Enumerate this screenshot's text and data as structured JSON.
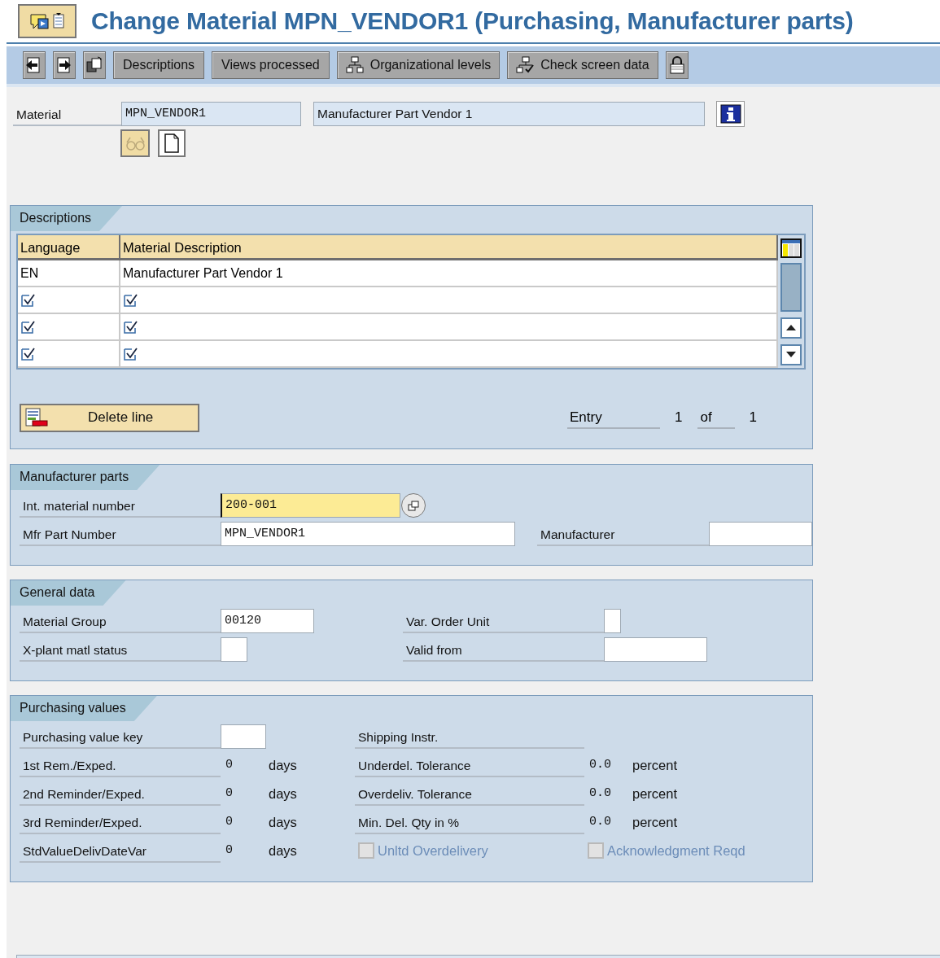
{
  "window": {
    "title": "Change Material MPN_VENDOR1 (Purchasing, Manufacturer parts)"
  },
  "toolbar": {
    "buttons": [
      {
        "kind": "prev"
      },
      {
        "kind": "next"
      },
      {
        "kind": "other"
      },
      {
        "kind": "text",
        "label": "Descriptions"
      },
      {
        "kind": "text",
        "label": "Views processed"
      },
      {
        "kind": "org",
        "label": "Organizational levels"
      },
      {
        "kind": "check",
        "label": "Check screen data"
      },
      {
        "kind": "lock"
      }
    ]
  },
  "header": {
    "label": "Material",
    "value": "MPN_VENDOR1",
    "description": "Manufacturer Part Vendor 1"
  },
  "descriptions": {
    "title": "Descriptions",
    "columns": [
      "Language",
      "Material Description"
    ],
    "rows": [
      {
        "kind": "filled",
        "cells": [
          "EN",
          "Manufacturer Part Vendor 1"
        ]
      },
      {
        "kind": "empty"
      },
      {
        "kind": "empty"
      },
      {
        "kind": "empty"
      }
    ],
    "delete_button": "Delete line",
    "entry": {
      "label": "Entry",
      "current": "1",
      "of": "of",
      "total": "1"
    }
  },
  "manufacturer_parts": {
    "title": "Manufacturer parts",
    "rows": [
      {
        "cells": [
          {
            "kind": "input",
            "label": "Int. material number",
            "value": "200-001",
            "focused": true
          }
        ]
      },
      {
        "cells": [
          {
            "kind": "input",
            "label": "Mfr Part Number",
            "value": "MPN_VENDOR1",
            "focused": false
          },
          {
            "kind": "input",
            "label": "Manufacturer",
            "focused": false
          }
        ]
      }
    ]
  },
  "general_data": {
    "title": "General data",
    "rows": [
      {
        "cells": [
          {
            "kind": "input",
            "label": "Material Group",
            "value": "00120"
          },
          {
            "kind": "input",
            "label": "Var. Order Unit"
          }
        ]
      },
      {
        "cells": [
          {
            "kind": "input",
            "label": "X-plant matl status"
          },
          {
            "kind": "input",
            "label": "Valid from"
          }
        ]
      }
    ]
  },
  "purchasing_values": {
    "title": "Purchasing values",
    "rows": [
      {
        "cells": [
          {
            "kind": "input",
            "label": "Purchasing value key"
          },
          {
            "kind": "label",
            "label": "Shipping Instr."
          }
        ]
      },
      {
        "cells": [
          {
            "kind": "value",
            "label": "1st Rem./Exped.",
            "value": "0",
            "unit": "days"
          },
          {
            "kind": "value",
            "label": "Underdel. Tolerance",
            "value": "0.0",
            "unit": "percent"
          }
        ]
      },
      {
        "cells": [
          {
            "kind": "value",
            "label": "2nd Reminder/Exped.",
            "value": "0",
            "unit": "days"
          },
          {
            "kind": "value",
            "label": "Overdeliv. Tolerance",
            "value": "0.0",
            "unit": "percent"
          }
        ]
      },
      {
        "cells": [
          {
            "kind": "value",
            "label": "3rd Reminder/Exped.",
            "value": "0",
            "unit": "days"
          },
          {
            "kind": "value",
            "label": "Min. Del. Qty in %",
            "value": "0.0",
            "unit": "percent"
          }
        ]
      },
      {
        "cells": [
          {
            "kind": "value",
            "label": "StdValueDelivDateVar",
            "value": "0",
            "unit": "days"
          },
          {
            "kind": "checkbox",
            "label": "Unltd Overdelivery",
            "checked": false,
            "disabled": true
          },
          {
            "kind": "checkbox",
            "label": "Acknowledgment Reqd",
            "checked": false,
            "disabled": true
          }
        ]
      }
    ]
  }
}
